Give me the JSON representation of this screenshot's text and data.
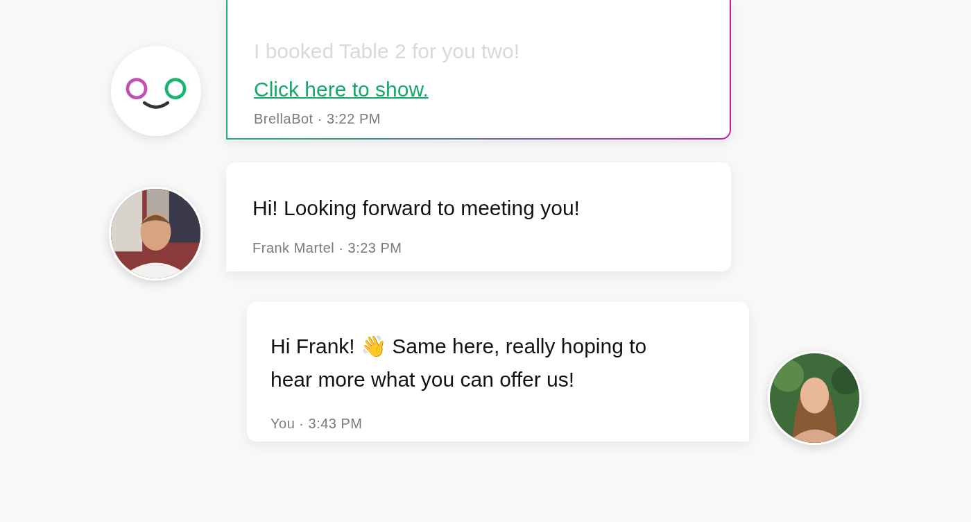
{
  "messages": [
    {
      "kind": "bot",
      "preview": "I booked Table 2 for you two!",
      "link": "Click here to show.",
      "meta": "BrellaBot · 3:22 PM"
    },
    {
      "kind": "incoming",
      "text": "Hi! Looking forward to meeting you!",
      "meta": "Frank Martel · 3:23 PM"
    },
    {
      "kind": "outgoing",
      "text": "Hi Frank! 👋 Same here, really hoping to hear more what you can offer us!",
      "meta": "You · 3:43 PM"
    }
  ]
}
